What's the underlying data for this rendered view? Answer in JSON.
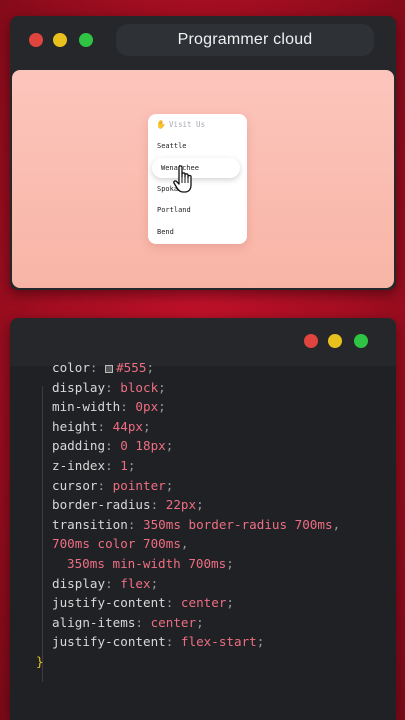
{
  "top_window": {
    "title": "Programmer cloud",
    "menu": {
      "header": "Visit Us",
      "header_icon": "waving-hand-icon",
      "items": [
        {
          "label": "Seattle"
        },
        {
          "label": "Wenatchee",
          "hovered": true
        },
        {
          "label": "Spokane"
        },
        {
          "label": "Portland"
        },
        {
          "label": "Bend"
        }
      ]
    }
  },
  "code_window": {
    "lines": [
      {
        "prop": "color",
        "sep": ":",
        "value": "#555",
        "end": ";"
      },
      {
        "prop": "display",
        "sep": ":",
        "value": "block",
        "end": ";"
      },
      {
        "prop": "min-width",
        "sep": ":",
        "value": "0px",
        "end": ";"
      },
      {
        "prop": "height",
        "sep": ":",
        "value": "44px",
        "end": ";"
      },
      {
        "prop": "padding",
        "sep": ":",
        "value": "0 18px",
        "end": ";"
      },
      {
        "prop": "z-index",
        "sep": ":",
        "value": "1",
        "end": ";"
      },
      {
        "prop": "cursor",
        "sep": ":",
        "value": "pointer",
        "end": ";"
      },
      {
        "prop": "border-radius",
        "sep": ":",
        "value": "22px",
        "end": ";"
      },
      {
        "prop": "transition",
        "sep": ":",
        "value": "350ms border-radius 700ms",
        "end": ","
      },
      {
        "prop": "",
        "sep": "",
        "value": "700ms color 700ms",
        "end": ","
      },
      {
        "prop": "",
        "sep": "",
        "value": "350ms min-width 700ms",
        "end": ";"
      },
      {
        "prop": "display",
        "sep": ":",
        "value": "flex",
        "end": ";"
      },
      {
        "prop": "justify-content",
        "sep": ":",
        "value": "center",
        "end": ";"
      },
      {
        "prop": "align-items",
        "sep": ":",
        "value": "center",
        "end": ";"
      },
      {
        "prop": "justify-content",
        "sep": ":",
        "value": "flex-start",
        "end": ";"
      }
    ],
    "closing_brace": "}"
  },
  "colors": {
    "background": "#b30f25",
    "window": "#25272b",
    "preview_gradient_top": "#fcc5bc",
    "preview_gradient_bottom": "#f8b5a6",
    "code_value": "#ee6e83",
    "close_dot": "#e0443e",
    "minimize_dot": "#e8c11f",
    "maximize_dot": "#2fc444"
  }
}
